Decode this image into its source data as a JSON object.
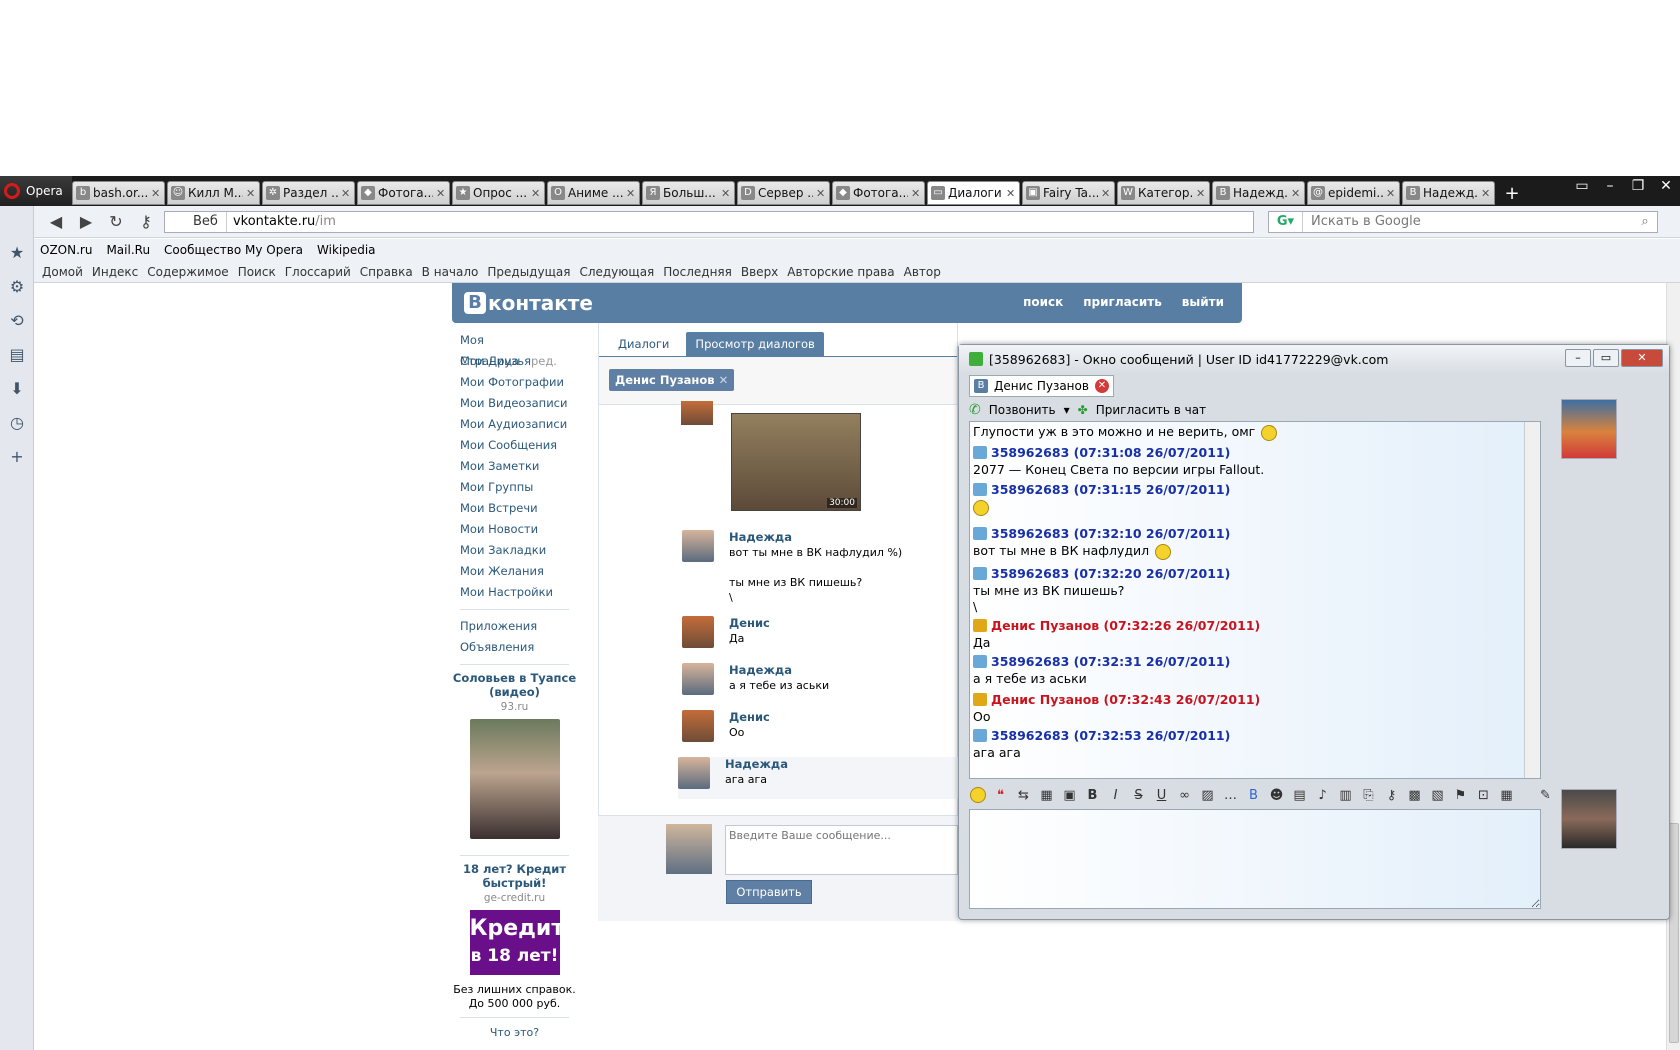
{
  "browser": {
    "name": "Opera",
    "tabs": [
      {
        "fav": "b",
        "title": "bash.or..."
      },
      {
        "fav": "☺",
        "title": "Килл М..."
      },
      {
        "fav": "✲",
        "title": "Раздел ..."
      },
      {
        "fav": "◆",
        "title": "Фотога..."
      },
      {
        "fav": "★",
        "title": "Опрос ..."
      },
      {
        "fav": "O",
        "title": "Аниме ..."
      },
      {
        "fav": "Я",
        "title": "Больш..."
      },
      {
        "fav": "D",
        "title": "Сервер ..."
      },
      {
        "fav": "◆",
        "title": "Фотога..."
      },
      {
        "fav": "▭",
        "title": "Диалоги"
      },
      {
        "fav": "▣",
        "title": "Fairy Ta..."
      },
      {
        "fav": "W",
        "title": "Категор..."
      },
      {
        "fav": "B",
        "title": "Надежд..."
      },
      {
        "fav": "@",
        "title": "epidemi..."
      },
      {
        "fav": "B",
        "title": "Надежд..."
      }
    ],
    "active_tab": 9,
    "url_prefix": "Веб",
    "url": "vkontakte.ru",
    "url_path": "/im",
    "search_placeholder": "Искать в Google",
    "bookmarks": [
      "OZON.ru",
      "Mail.Ru",
      "Сообщество My Opera",
      "Wikipedia"
    ],
    "nav_links": [
      "Домой",
      "Индекс",
      "Содержимое",
      "Поиск",
      "Глоссарий",
      "Справка",
      "В начало",
      "Предыдущая",
      "Следующая",
      "Последняя",
      "Вверх",
      "Авторские права",
      "Автор"
    ]
  },
  "vk": {
    "logo": "контакте",
    "logo_b": "В",
    "top_links": [
      "поиск",
      "пригласить",
      "выйти"
    ],
    "menu": [
      "Моя Страница",
      "Мои Друзья",
      "Мои Фотографии",
      "Мои Видеозаписи",
      "Мои Аудиозаписи",
      "Мои Сообщения",
      "Мои Заметки",
      "Мои Группы",
      "Мои Встречи",
      "Мои Новости",
      "Мои Закладки",
      "Мои Желания",
      "Мои Настройки"
    ],
    "edit": "ред.",
    "menu2": [
      "Приложения",
      "Объявления"
    ],
    "ad1": {
      "title": "Соловьев в Туапсе (видео)",
      "sub": "93.ru"
    },
    "ad2": {
      "title": "18 лет? Кредит быстрый!",
      "sub": "ge-credit.ru",
      "img_l1": "Кредит",
      "img_l2": "в 18 лет!",
      "text": "Без лишних справок. До 500 000 руб."
    },
    "what": "Что это?",
    "tabs": [
      "Диалоги",
      "Просмотр диалогов"
    ],
    "peer": "Денис Пузанов",
    "video_time": "30:00",
    "messages": [
      {
        "name": "Надежда",
        "text": "вот ты мне в ВК нафлудил %)\n\nты мне из ВК пишешь?\n\\"
      },
      {
        "name": "Денис",
        "text": "Да"
      },
      {
        "name": "Надежда",
        "text": "а я тебе из аськи"
      },
      {
        "name": "Денис",
        "text": "Оо"
      },
      {
        "name": "Надежда",
        "text": "ага ага"
      }
    ],
    "compose_placeholder": "Введите Ваше сообщение...",
    "send": "Отправить"
  },
  "qip": {
    "title": "[358962683] - Окно сообщений | User ID id41772229@vk.com",
    "tab": "Денис Пузанов",
    "call": "Позвонить",
    "invite": "Пригласить в чат",
    "first_line": "Глупости уж в это можно и не верить, омг",
    "msgs": [
      {
        "h": "358962683 (07:31:08 26/07/2011)",
        "b": "2077 — Конец Света по версии игры Fallout.",
        "me": false
      },
      {
        "h": "358962683 (07:31:15 26/07/2011)",
        "b": "",
        "me": false
      },
      {
        "h": "358962683 (07:32:10 26/07/2011)",
        "b": "вот ты мне в ВК нафлудил",
        "me": false
      },
      {
        "h": "358962683 (07:32:20 26/07/2011)",
        "b": "ты мне из ВК пишешь?\n\\",
        "me": false
      },
      {
        "h": "Денис Пузанов (07:32:26 26/07/2011)",
        "b": "Да",
        "me": true
      },
      {
        "h": "358962683 (07:32:31 26/07/2011)",
        "b": "а я тебе из аськи",
        "me": false
      },
      {
        "h": "Денис Пузанов (07:32:43 26/07/2011)",
        "b": "Оо",
        "me": true
      },
      {
        "h": "358962683 (07:32:53 26/07/2011)",
        "b": "ага ага",
        "me": false
      }
    ]
  }
}
